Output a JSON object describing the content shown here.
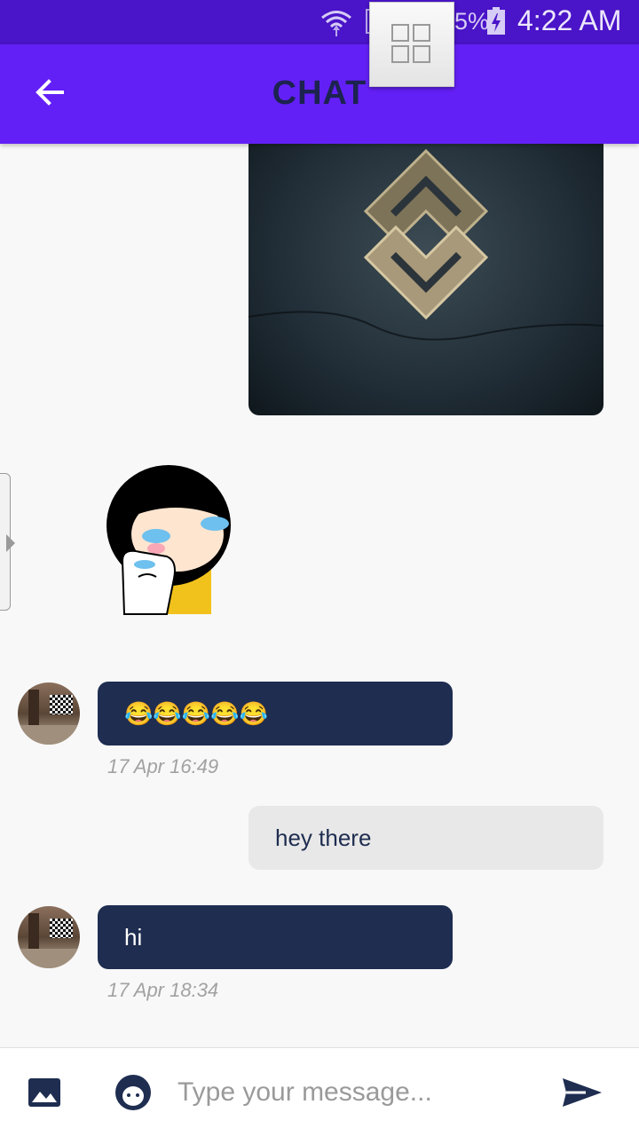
{
  "status_bar": {
    "battery_percent": "5%",
    "time": "4:22 AM"
  },
  "app_bar": {
    "title": "CHAT"
  },
  "messages": [
    {
      "type": "image",
      "direction": "outgoing"
    },
    {
      "type": "sticker",
      "direction": "incoming"
    },
    {
      "type": "text",
      "direction": "incoming",
      "text": "😂😂😂😂😂",
      "timestamp": "17 Apr 16:49"
    },
    {
      "type": "text",
      "direction": "outgoing",
      "text": "hey there"
    },
    {
      "type": "text",
      "direction": "incoming",
      "text": "hi",
      "timestamp": "17 Apr 18:34"
    }
  ],
  "composer": {
    "placeholder": "Type your message..."
  },
  "colors": {
    "status_bar": "#4a14c8",
    "app_bar": "#6320f6",
    "incoming_bubble": "#1e2d50",
    "outgoing_bubble": "#e8e8e8"
  },
  "icons": {
    "back": "arrow-left-icon",
    "image_picker": "image-icon",
    "emoji_picker": "smiley-face-icon",
    "send": "send-icon",
    "overlay": "grid-icon"
  }
}
